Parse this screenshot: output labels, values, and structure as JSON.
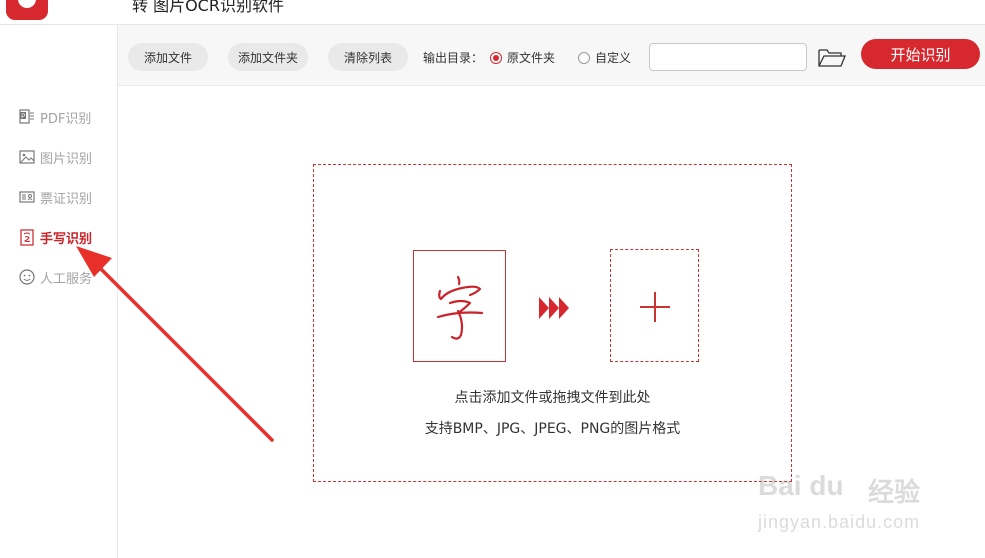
{
  "app": {
    "title": "转  图片OCR识别软件"
  },
  "sidebar": {
    "items": [
      {
        "label": "PDF识别",
        "icon": "pdf-icon",
        "active": false
      },
      {
        "label": "图片识别",
        "icon": "image-icon",
        "active": false
      },
      {
        "label": "票证识别",
        "icon": "id-card-icon",
        "active": false
      },
      {
        "label": "手写识别",
        "icon": "handwriting-icon",
        "active": true
      },
      {
        "label": "人工服务",
        "icon": "smiley-icon",
        "active": false
      }
    ]
  },
  "toolbar": {
    "add_file": "添加文件",
    "add_folder": "添加文件夹",
    "clear_list": "清除列表",
    "output_label": "输出目录：",
    "radio_original": "原文件夹",
    "radio_custom": "自定义",
    "selected_output": "原文件夹",
    "path_value": "",
    "start": "开始识别"
  },
  "dropzone": {
    "sample_char": "字",
    "line1": "点击添加文件或拖拽文件到此处",
    "line2": "支持BMP、JPG、JPEG、PNG的图片格式"
  },
  "watermark": {
    "logo": "Bai du",
    "brand_cn": "经验",
    "url": "jingyan.baidu.com"
  },
  "colors": {
    "accent": "#d7282f",
    "sidebar_text": "#a3a3a3",
    "annotation_arrow": "#e8302a"
  }
}
